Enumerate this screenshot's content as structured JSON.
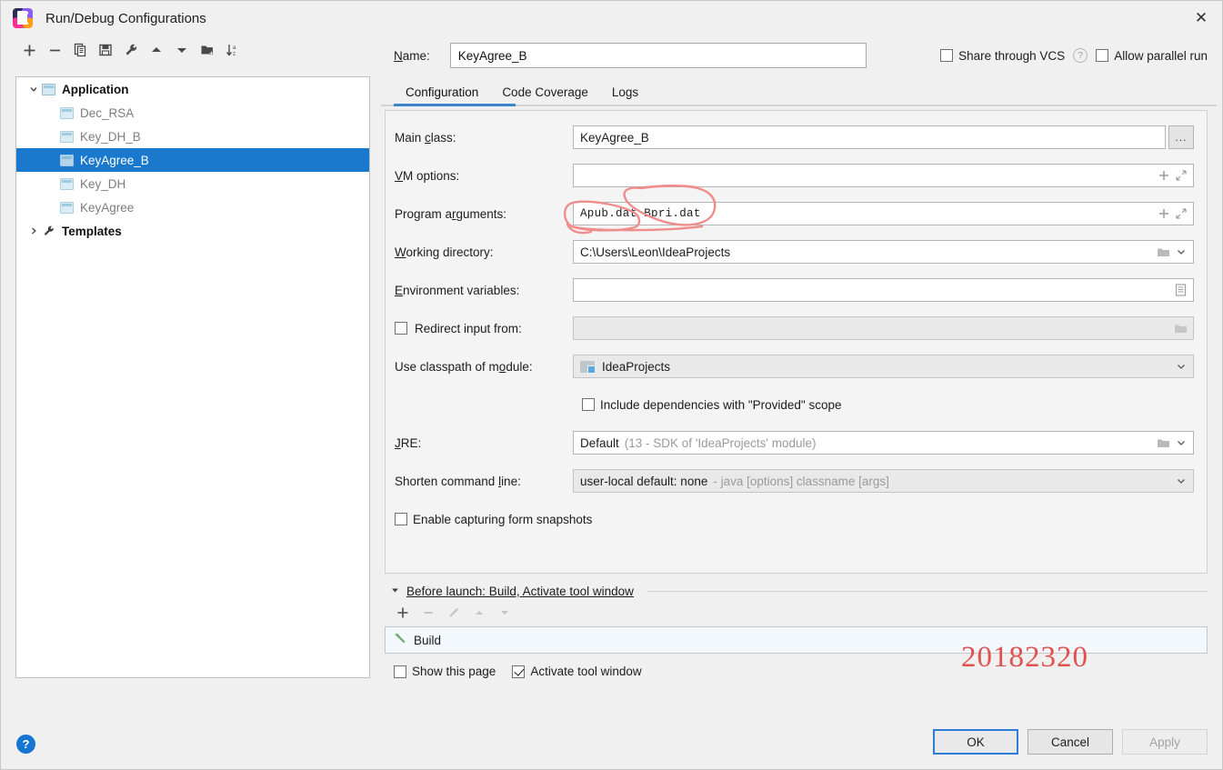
{
  "window": {
    "title": "Run/Debug Configurations",
    "app_icon": "intellij-idea-logo",
    "close_label": "✕"
  },
  "toolbar": {
    "items": [
      {
        "name": "add-configuration",
        "icon": "plus-icon",
        "label": "+"
      },
      {
        "name": "remove-configuration",
        "icon": "minus-icon",
        "label": "−"
      },
      {
        "name": "copy-configuration",
        "icon": "copy-icon",
        "label": ""
      },
      {
        "name": "save-configuration",
        "icon": "save-icon",
        "label": ""
      },
      {
        "name": "edit-templates",
        "icon": "wrench-icon",
        "label": ""
      },
      {
        "name": "move-up",
        "icon": "arrow-up-icon",
        "label": ""
      },
      {
        "name": "move-down",
        "icon": "arrow-down-icon",
        "label": ""
      },
      {
        "name": "new-folder",
        "icon": "folder-add-icon",
        "label": ""
      },
      {
        "name": "sort-configurations",
        "icon": "sort-az-icon",
        "label": ""
      }
    ]
  },
  "tree": {
    "root": {
      "label": "Application",
      "icon": "application-icon",
      "expanded": true,
      "chevron": "⌄"
    },
    "children": [
      {
        "label": "Dec_RSA",
        "selected": false
      },
      {
        "label": "Key_DH_B",
        "selected": false
      },
      {
        "label": "KeyAgree_B",
        "selected": true
      },
      {
        "label": "Key_DH",
        "selected": false
      },
      {
        "label": "KeyAgree",
        "selected": false
      }
    ],
    "templates": {
      "label": "Templates",
      "icon": "wrench-icon",
      "expanded": false,
      "chevron": "›"
    }
  },
  "header": {
    "name_label": "Name:",
    "name_value": "KeyAgree_B",
    "share_vcs_label": "Share through VCS",
    "share_vcs_checked": false,
    "share_vcs_help_icon": "question-icon",
    "allow_parallel_label": "Allow parallel run",
    "allow_parallel_checked": false
  },
  "tabs": [
    {
      "label": "Configuration",
      "active": true
    },
    {
      "label": "Code Coverage",
      "active": false
    },
    {
      "label": "Logs",
      "active": false
    }
  ],
  "form": {
    "main_class": {
      "label": "Main class:",
      "value": "KeyAgree_B",
      "browse_label": "...",
      "browse_icon": "ellipsis-icon"
    },
    "vm_options": {
      "label": "VM options:",
      "value": "",
      "icons": [
        "plus-icon",
        "expand-icon"
      ]
    },
    "program_arguments": {
      "label": "Program arguments:",
      "value": "Apub.dat Bpri.dat",
      "icons": [
        "plus-icon",
        "expand-icon"
      ]
    },
    "working_directory": {
      "label": "Working directory:",
      "value": "C:\\Users\\Leon\\IdeaProjects",
      "icons": [
        "folder-icon",
        "chevron-down-icon"
      ]
    },
    "environment_variables": {
      "label": "Environment variables:",
      "value": "",
      "icons": [
        "list-icon"
      ]
    },
    "redirect_input": {
      "label": "Redirect input from:",
      "checked": false,
      "value": "",
      "icons": [
        "folder-icon"
      ]
    },
    "use_classpath": {
      "label": "Use classpath of module:",
      "value": "IdeaProjects",
      "item_icon": "module-icon",
      "icons": [
        "chevron-down-icon"
      ]
    },
    "include_dependencies": {
      "label": "Include dependencies with \"Provided\" scope",
      "checked": false
    },
    "jre": {
      "label": "JRE:",
      "value": "Default",
      "hint": "(13 - SDK of 'IdeaProjects' module)",
      "icons": [
        "folder-icon",
        "chevron-down-icon"
      ]
    },
    "shorten_command_line": {
      "label": "Shorten command line:",
      "value": "user-local default: none",
      "hint": "- java [options] classname [args]",
      "icons": [
        "chevron-down-icon"
      ]
    },
    "enable_snapshots": {
      "label": "Enable capturing form snapshots",
      "checked": false
    }
  },
  "before_launch": {
    "title": "Before launch: Build, Activate tool window",
    "collapse_icon": "triangle-down-icon",
    "tools": [
      {
        "name": "add-task",
        "icon": "plus-icon",
        "label": "+",
        "enabled": true
      },
      {
        "name": "remove-task",
        "icon": "minus-icon",
        "label": "−",
        "enabled": false
      },
      {
        "name": "edit-task",
        "icon": "pencil-icon",
        "label": "",
        "enabled": false
      },
      {
        "name": "move-task-up",
        "icon": "arrow-up-icon",
        "label": "",
        "enabled": false
      },
      {
        "name": "move-task-down",
        "icon": "arrow-down-icon",
        "label": "",
        "enabled": false
      }
    ],
    "tasks": [
      {
        "label": "Build",
        "icon": "hammer-icon"
      }
    ],
    "show_this_page": {
      "label": "Show this page",
      "checked": false
    },
    "activate_tool_window": {
      "label": "Activate tool window",
      "checked": true
    }
  },
  "annotation": {
    "stamp_text": "20182320",
    "stamp_color": "#e0514f",
    "marker_color": "#ef8d8d",
    "circles_target": "program-arguments-value"
  },
  "footer": {
    "help_icon": "question-icon",
    "help_label": "?",
    "buttons": [
      {
        "label": "OK",
        "style": "primary",
        "enabled": true
      },
      {
        "label": "Cancel",
        "style": "normal",
        "enabled": true
      },
      {
        "label": "Apply",
        "style": "disabled",
        "enabled": false
      }
    ]
  },
  "colors": {
    "selection_blue": "#1b79cd",
    "tab_underline": "#3c83c9",
    "primary_border": "#2d7cd6",
    "build_green": "#6fae6f",
    "help_blue": "#1675d1"
  }
}
